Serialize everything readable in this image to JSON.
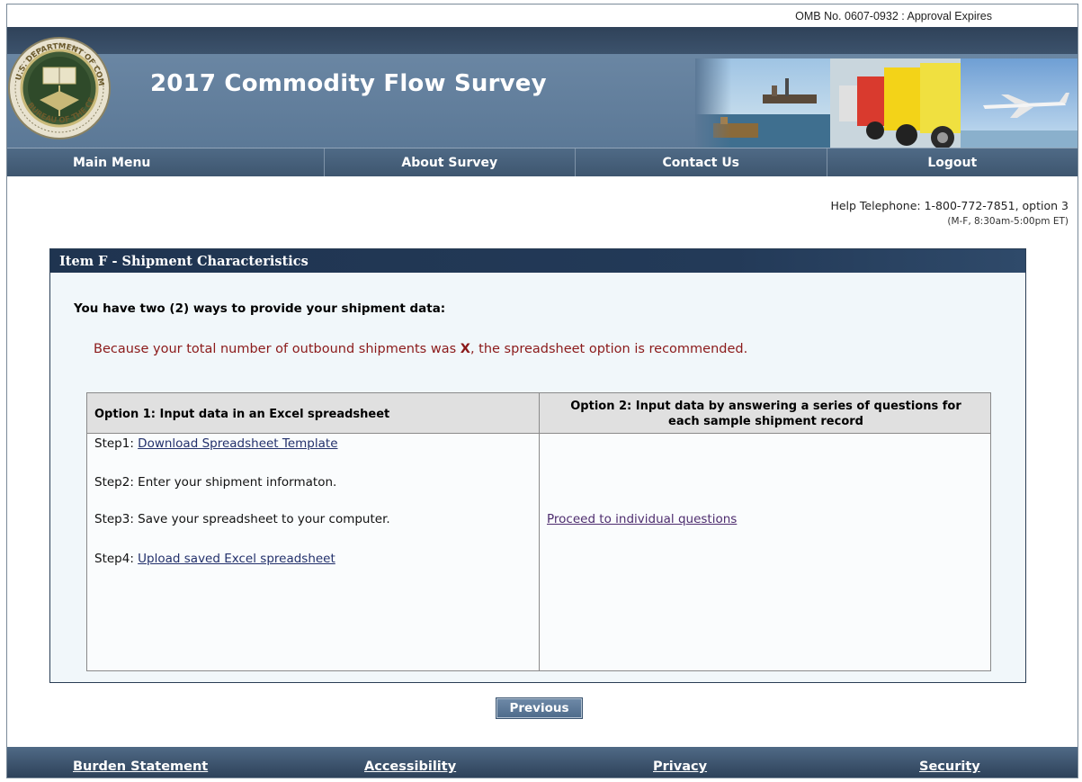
{
  "omb": {
    "text": "OMB No. 0607-0932 :  Approval Expires"
  },
  "header": {
    "title": "2017 Commodity Flow Survey",
    "seal_text": "U.S. DEPARTMENT OF COMMERCE · BUREAU OF THE CENSUS",
    "photos": [
      "ship-port-photo",
      "trucks-photo",
      "airplane-photo"
    ]
  },
  "nav": {
    "items": [
      {
        "label": "Main Menu"
      },
      {
        "label": "About Survey"
      },
      {
        "label": "Contact Us"
      },
      {
        "label": "Logout"
      }
    ]
  },
  "help": {
    "telephone": "Help Telephone: 1-800-772-7851, option 3",
    "hours": "(M-F, 8:30am-5:00pm ET)"
  },
  "panel": {
    "title": "Item F - Shipment Characteristics",
    "intro": "You have two (2) ways to provide your shipment data:",
    "notice_before": "Because your total number of outbound shipments was ",
    "notice_x": "X",
    "notice_after": ", the spreadsheet option is recommended."
  },
  "options": {
    "option1_title": "Option 1: Input data in an Excel spreadsheet",
    "option2_title_line1": "Option 2: Input data by answering a series of questions for",
    "option2_title_line2": "each sample shipment record",
    "step1_prefix": "Step1: ",
    "step1_link": "Download Spreadsheet Template",
    "step2": "Step2: Enter your shipment informaton.",
    "step3": "Step3: Save your spreadsheet to your computer.",
    "step4_prefix": "Step4: ",
    "step4_link": "Upload saved Excel spreadsheet",
    "proceed_link": "Proceed to individual questions"
  },
  "buttons": {
    "previous": "Previous"
  },
  "footer": {
    "links": [
      {
        "label": "Burden Statement"
      },
      {
        "label": "Accessibility"
      },
      {
        "label": "Privacy"
      },
      {
        "label": "Security"
      }
    ]
  },
  "colors": {
    "header_blue": "#5b7693",
    "nav_blue": "#4f6a86",
    "panel_head": "#1f3450",
    "notice_red": "#8b1a1a",
    "link_blue": "#22306b"
  }
}
